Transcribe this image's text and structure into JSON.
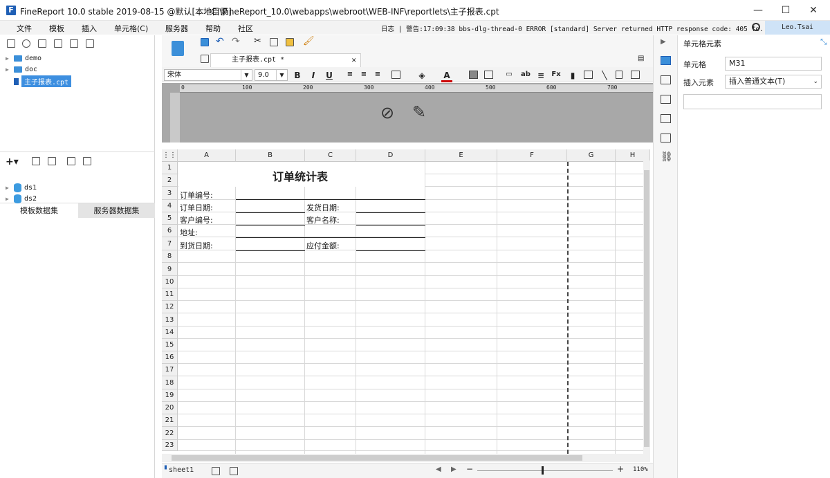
{
  "window": {
    "app_logo": "F",
    "app_title": "FineReport 10.0 stable 2019-08-15 @默认[本地目录]",
    "file_path": "C:\\FineReport_10.0\\webapps\\webroot\\WEB-INF\\reportlets\\主子报表.cpt",
    "minimize": "—",
    "maximize": "☐",
    "close": "✕"
  },
  "menu": [
    "文件",
    "模板",
    "插入",
    "单元格(C)",
    "服务器",
    "帮助",
    "社区"
  ],
  "log": "日志 | 警告:17:09:38 bbs-dlg-thread-0 ERROR [standard] Server returned HTTP response code: 405 fo...",
  "user": "Leo.Tsai",
  "tree": [
    {
      "label": "demo",
      "type": "folder"
    },
    {
      "label": "doc",
      "type": "folder"
    },
    {
      "label": "主子报表.cpt",
      "type": "file",
      "selected": true
    }
  ],
  "dataset_tabs": [
    "模板数据集",
    "服务器数据集"
  ],
  "datasets": [
    "ds1",
    "ds2"
  ],
  "doc_tab": "主子报表.cpt *",
  "font": {
    "family": "宋体",
    "size": "9.0"
  },
  "ruler_labels": [
    "0",
    "100",
    "200",
    "300",
    "400",
    "500",
    "600",
    "700"
  ],
  "columns": [
    "A",
    "B",
    "C",
    "D",
    "E",
    "F",
    "G",
    "H"
  ],
  "rows": [
    "1",
    "2",
    "3",
    "4",
    "5",
    "6",
    "7",
    "8",
    "9",
    "10",
    "11",
    "12",
    "13",
    "14",
    "15",
    "16",
    "17",
    "18",
    "19",
    "20",
    "21",
    "22",
    "23"
  ],
  "report": {
    "title": "订单统计表",
    "order_no": "订单编号:",
    "order_date": "订单日期:",
    "ship_date": "发货日期:",
    "customer_no": "客户编号:",
    "customer_name": "客户名称:",
    "address": "地址:",
    "arrive_date": "到货日期:",
    "amount_due": "应付金额:"
  },
  "sheet": "sheet1",
  "zoom": "110%",
  "right_panel": {
    "title": "单元格元素",
    "cell_label": "单元格",
    "cell_value": "M31",
    "insert_label": "插入元素",
    "insert_value": "插入普通文本(T)"
  }
}
